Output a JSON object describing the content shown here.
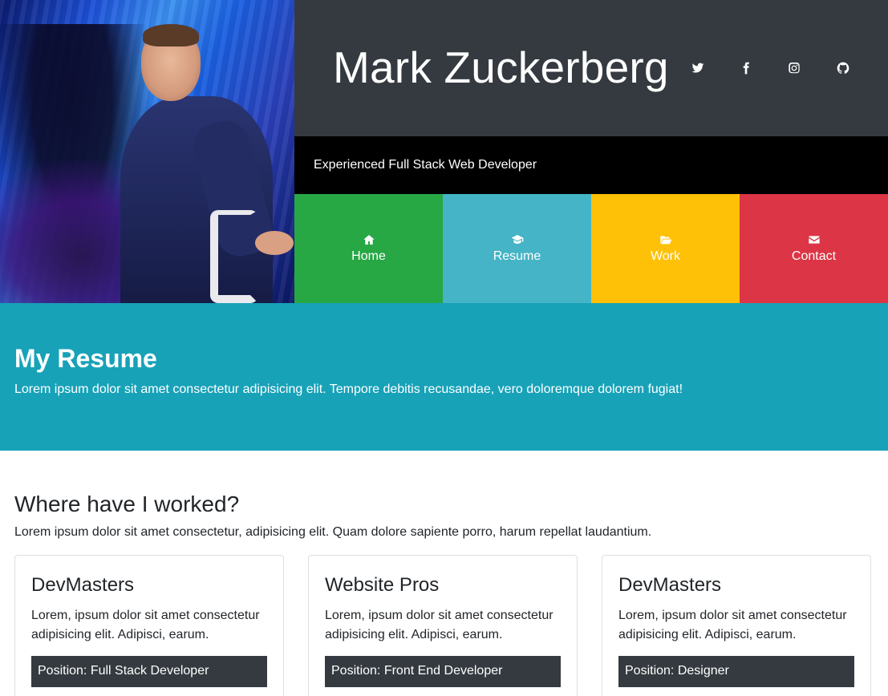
{
  "header": {
    "name": "Mark Zuckerberg",
    "tagline": "Experienced Full Stack Web Developer",
    "social": [
      {
        "icon": "twitter-icon"
      },
      {
        "icon": "facebook-icon"
      },
      {
        "icon": "instagram-icon"
      },
      {
        "icon": "github-icon"
      }
    ]
  },
  "nav": [
    {
      "label": "Home",
      "icon": "home-icon",
      "color": "#28a745"
    },
    {
      "label": "Resume",
      "icon": "graduation-cap-icon",
      "color": "#45b4c6"
    },
    {
      "label": "Work",
      "icon": "folder-open-icon",
      "color": "#ffc107"
    },
    {
      "label": "Contact",
      "icon": "envelope-icon",
      "color": "#dc3545"
    }
  ],
  "resume": {
    "title": "My Resume",
    "text": "Lorem ipsum dolor sit amet consectetur adipisicing elit. Tempore debitis recusandae, vero doloremque dolorem fugiat!"
  },
  "worked": {
    "title": "Where have I worked?",
    "text": "Lorem ipsum dolor sit amet consectetur, adipisicing elit. Quam dolore sapiente porro, harum repellat laudantium.",
    "cards": [
      {
        "company": "DevMasters",
        "text": "Lorem, ipsum dolor sit amet consectetur adipisicing elit. Adipisci, earum.",
        "position": "Position: Full Stack Developer"
      },
      {
        "company": "Website Pros",
        "text": "Lorem, ipsum dolor sit amet consectetur adipisicing elit. Adipisci, earum.",
        "position": "Position: Front End Developer"
      },
      {
        "company": "DevMasters",
        "text": "Lorem, ipsum dolor sit amet consectetur adipisicing elit. Adipisci, earum.",
        "position": "Position: Designer"
      }
    ]
  },
  "colors": {
    "header_bg": "#343a40",
    "tagline_bg": "#000000",
    "banner_bg": "#17a2b8",
    "position_bg": "#343a40"
  }
}
